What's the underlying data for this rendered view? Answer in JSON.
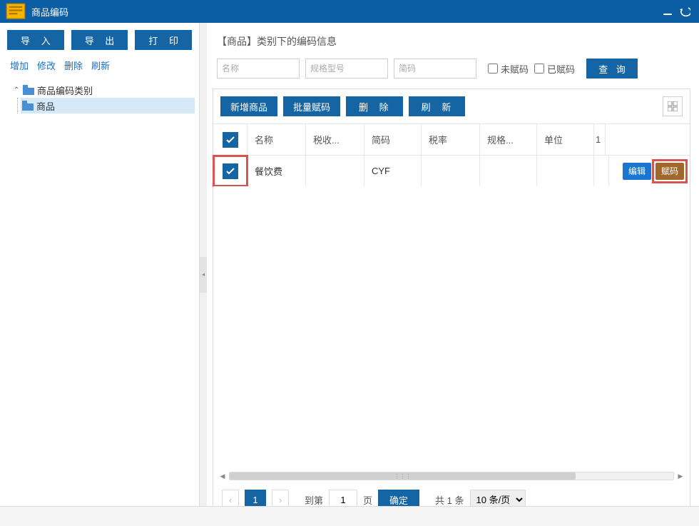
{
  "titlebar": {
    "title": "商品编码"
  },
  "left": {
    "buttons": {
      "import": "导 入",
      "export": "导 出",
      "print": "打 印"
    },
    "links": {
      "add": "增加",
      "edit": "修改",
      "delete": "删除",
      "refresh": "刷新"
    },
    "tree": {
      "root": "商品编码类别",
      "child": "商品"
    }
  },
  "main": {
    "heading": "【商品】类别下的编码信息",
    "filters": {
      "name_ph": "名称",
      "spec_ph": "规格型号",
      "code_ph": "简码",
      "unassigned": "未赋码",
      "assigned": "已赋码",
      "search": "查 询"
    },
    "toolbar": {
      "addProduct": "新增商品",
      "batchAssign": "批量赋码",
      "delete": "删  除",
      "refresh": "刷  新"
    },
    "columns": {
      "name": "名称",
      "taxcat": "税收...",
      "code": "简码",
      "rate": "税率",
      "spec": "规格...",
      "unit": "单位",
      "extra": "1"
    },
    "rows": [
      {
        "name": "餐饮费",
        "taxcat": "",
        "code": "CYF",
        "rate": "",
        "spec": "",
        "unit": "",
        "checked": true
      }
    ],
    "rowActions": {
      "edit": "编辑",
      "assign": "赋码"
    },
    "pager": {
      "current": "1",
      "gotoLabelA": "到第",
      "gotoValue": "1",
      "gotoLabelB": "页",
      "confirm": "确定",
      "total": "共 1 条",
      "perPage": "10 条/页"
    }
  }
}
